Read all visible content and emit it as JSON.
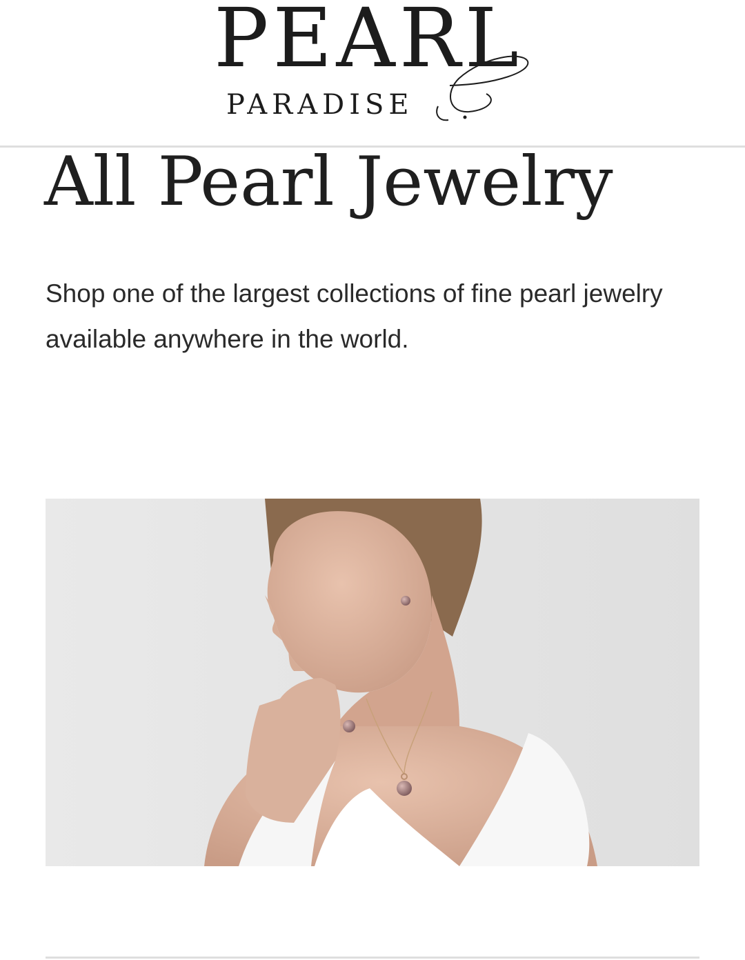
{
  "logo": {
    "word1": "PEARL",
    "word2": "PARADISE"
  },
  "page": {
    "title": "All Pearl Jewelry",
    "intro": "Shop one of the largest collections of fine pearl jewelry available anywhere in the world."
  },
  "hero": {
    "background_color": "#e4e4e4"
  },
  "colors": {
    "text": "#222222",
    "rule": "#dedede",
    "background": "#ffffff"
  }
}
